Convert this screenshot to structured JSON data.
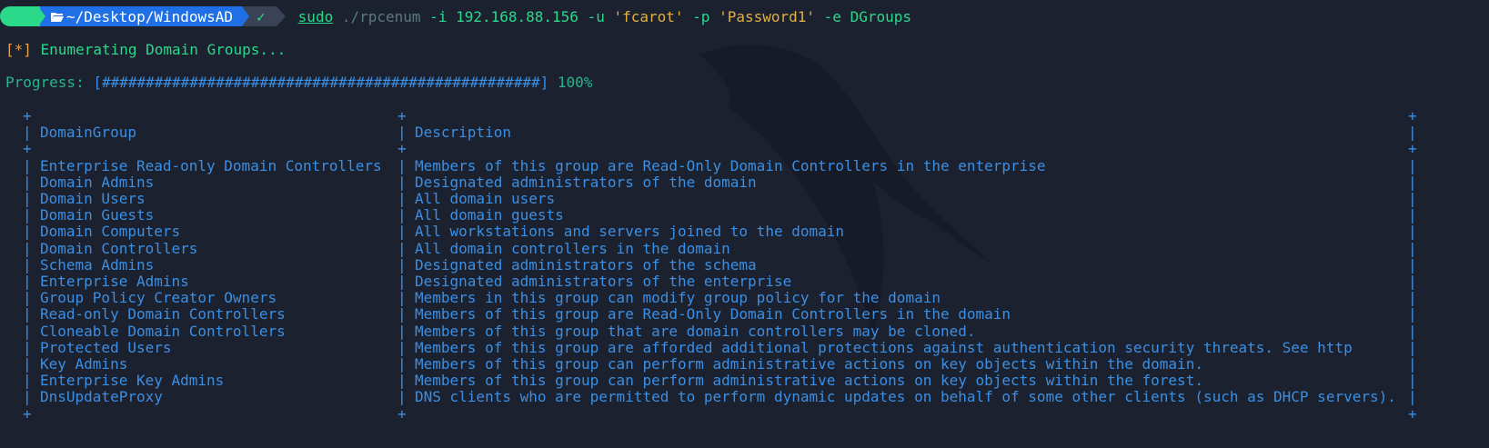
{
  "prompt": {
    "directory": "~/Desktop/WindowsAD",
    "status_mark": "✓",
    "command_sudo": "sudo",
    "command_prog": "./rpcenum",
    "command_args_1": " -i 192.168.88.156 -u ",
    "command_user": "'fcarot'",
    "command_args_2": " -p ",
    "command_pass": "'Password1'",
    "command_args_3": " -e DGroups"
  },
  "status": {
    "marker": "[*]",
    "message": " Enumerating Domain Groups..."
  },
  "progress": {
    "label": "Progress: ",
    "bar": "[##################################################]",
    "percent": " 100%"
  },
  "table": {
    "headers": [
      "DomainGroup",
      "Description"
    ],
    "rows": [
      [
        "Enterprise Read-only Domain Controllers",
        "Members of this group are Read-Only Domain Controllers in the enterprise"
      ],
      [
        "Domain Admins",
        "Designated administrators of the domain"
      ],
      [
        "Domain Users",
        "All domain users"
      ],
      [
        "Domain Guests",
        "All domain guests"
      ],
      [
        "Domain Computers",
        "All workstations and servers joined to the domain"
      ],
      [
        "Domain Controllers",
        "All domain controllers in the domain"
      ],
      [
        "Schema Admins",
        "Designated administrators of the schema"
      ],
      [
        "Enterprise Admins",
        "Designated administrators of the enterprise"
      ],
      [
        "Group Policy Creator Owners",
        "Members in this group can modify group policy for the domain"
      ],
      [
        "Read-only Domain Controllers",
        "Members of this group are Read-Only Domain Controllers in the domain"
      ],
      [
        "Cloneable Domain Controllers",
        "Members of this group that are domain controllers may be cloned."
      ],
      [
        "Protected Users",
        "Members of this group are afforded additional protections against authentication security threats. See http"
      ],
      [
        "Key Admins",
        "Members of this group can perform administrative actions on key objects within the domain."
      ],
      [
        "Enterprise Key Admins",
        "Members of this group can perform administrative actions on key objects within the forest."
      ],
      [
        "DnsUpdateProxy",
        "DNS clients who are permitted to perform dynamic updates on behalf of some other clients (such as DHCP servers)."
      ]
    ]
  },
  "colors": {
    "background": "#1c2130",
    "table_text": "#3a8fe4",
    "accent_green": "#2bd98a",
    "status_orange": "#e5a050"
  }
}
